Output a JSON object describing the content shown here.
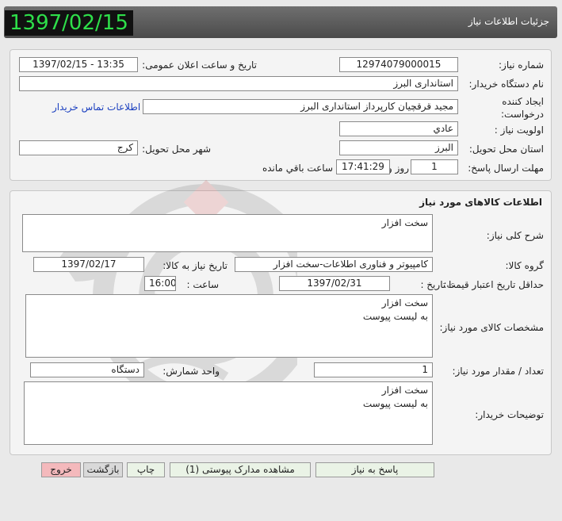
{
  "header": {
    "title": "جزئیات اطلاعات نیاز",
    "date": "1397/02/15"
  },
  "details": {
    "need_number_label": "شماره نیاز:",
    "need_number": "12974079000015",
    "announce_label": "تاریخ و ساعت اعلان عمومی:",
    "announce_value": "1397/02/15 - 13:35",
    "buyer_org_label": "نام دستگاه خریدار:",
    "buyer_org": "استانداری البرز",
    "creator_label_line1": "ایجاد کننده",
    "creator_label_line2": "درخواست:",
    "creator": "مجید قرقچیان کارپرداز استانداری البرز",
    "contact_link": "اطلاعات تماس خریدار",
    "priority_label": "اولویت نیاز :",
    "priority": "عادي",
    "province_label": "استان محل تحویل:",
    "province": "البرز",
    "city_label": "شهر محل تحویل:",
    "city": "کرج",
    "deadline_label": "مهلت ارسال پاسخ:",
    "deadline_days": "1",
    "day_and": "روز و",
    "deadline_time": "17:41:29",
    "remaining_text": "ساعت باقي مانده"
  },
  "goods": {
    "section_title": "اطلاعات کالاهای مورد نیاز",
    "summary_label": "شرح کلی نیاز:",
    "summary": "سخت افزار",
    "group_label": "گروه کالا:",
    "group": "کامپیوتر و فناوری اطلاعات-سخت افزار",
    "need_date_label": "تاریخ نیاز به کالا:",
    "need_date": "1397/02/17",
    "price_validity_label": "حداقل تاریخ اعتبار قیمت:",
    "until_date_label": "تا تاریخ :",
    "until_date": "1397/02/31",
    "time_label": "ساعت :",
    "time": "16:00",
    "specs_label": "مشخصات کالای مورد نیاز:",
    "specs": "سخت افزار\nبه لیست پیوست",
    "qty_label": "تعداد / مقدار مورد نیاز:",
    "qty": "1",
    "unit_label": "واحد شمارش:",
    "unit": "دستگاه",
    "buyer_notes_label": "توضیحات خریدار:",
    "buyer_notes": "سخت افزار\nبه لیست پیوست"
  },
  "buttons": {
    "reply": "پاسخ به نیاز",
    "attachments": "مشاهده مدارک پیوستی (1)",
    "print": "چاپ",
    "back": "بازگشت",
    "exit": "خروج"
  },
  "watermark_icon": "hezareh-gostar-logo-icon"
}
